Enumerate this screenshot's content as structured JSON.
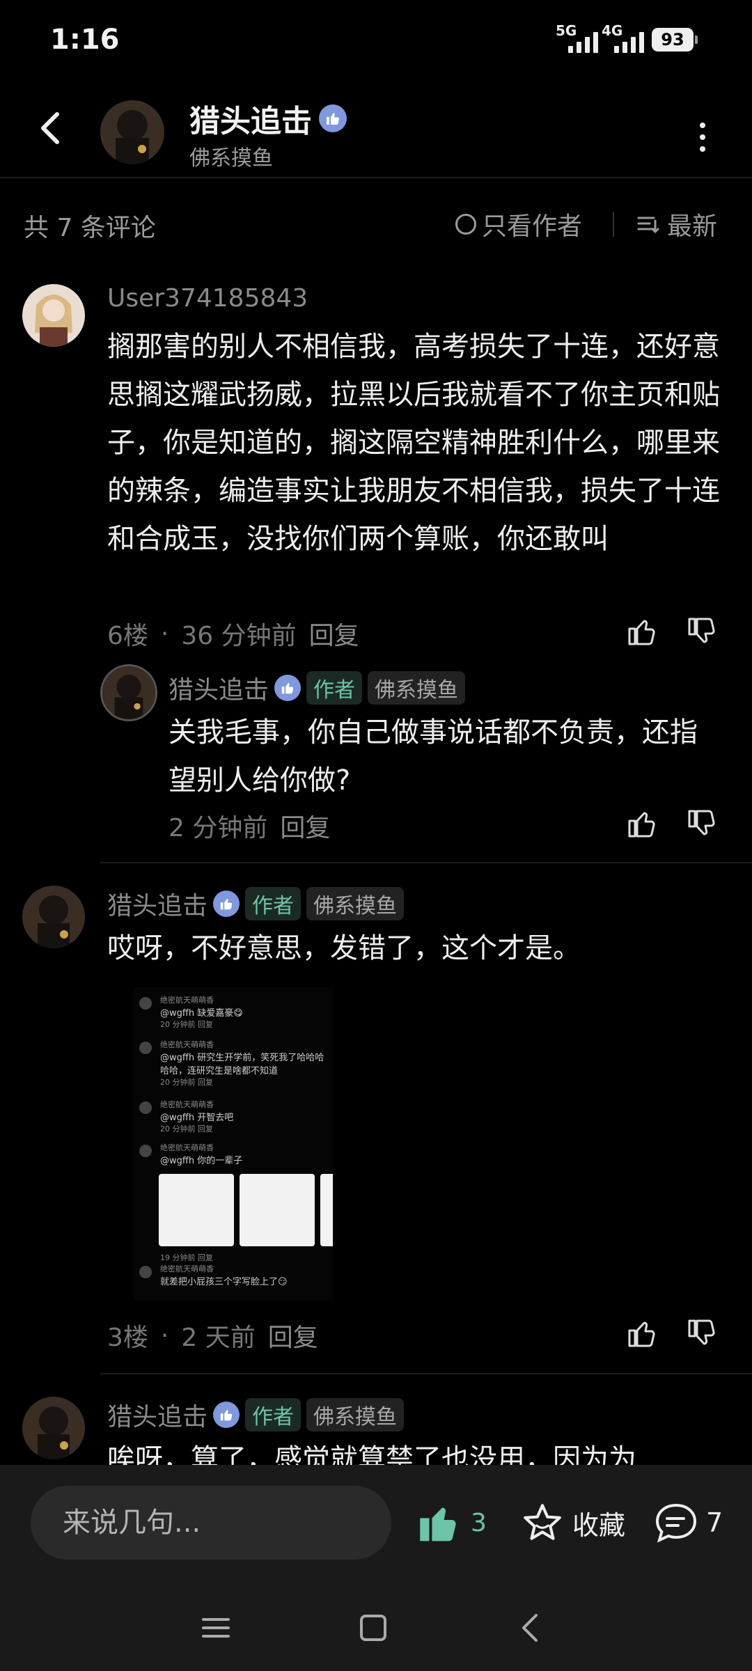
{
  "status_bar": {
    "time": "1:16",
    "signal_1": "5G",
    "signal_2": "4G",
    "battery": "93"
  },
  "header": {
    "title": "猎头追击",
    "subtitle": "佛系摸鱼",
    "back_icon": "back-arrow-icon",
    "more_icon": "more-vertical-icon",
    "verified_icon": "thumbs-up-badge-icon"
  },
  "filter": {
    "count": "共 7 条评论",
    "only_author": "只看作者",
    "sort": "最新"
  },
  "comments": [
    {
      "user": "User374185843",
      "text": "搁那害的别人不相信我，高考损失了十连，还好意思搁这耀武扬威，拉黑以后我就看不了你主页和贴子，你是知道的，搁这隔空精神胜利什么，哪里来的辣条，编造事实让我朋友不相信我，损失了十连和合成玉，没找你们两个算账，你还敢叫",
      "floor": "6楼",
      "time": "36 分钟前",
      "reply": "回复",
      "sub_reply": {
        "user": "猎头追击",
        "author_tag": "作者",
        "group_tag": "佛系摸鱼",
        "text": "关我毛事，你自己做事说话都不负责，还指望别人给你做?",
        "time": "2 分钟前",
        "reply": "回复"
      }
    },
    {
      "user": "猎头追击",
      "author_tag": "作者",
      "group_tag": "佛系摸鱼",
      "text": "哎呀，不好意思，发错了，这个才是。",
      "floor": "3楼",
      "time": "2 天前",
      "reply": "回复",
      "screenshot": {
        "rows": [
          {
            "name": "绝密航天萌萌香",
            "text": "@wgffh  缺爱嘉豪😋",
            "meta": "20 分钟前  回复"
          },
          {
            "name": "绝密航天萌萌香",
            "text": "@wgffh  研究生开学前，笑死我了哈哈哈哈哈，连研究生是啥都不知道",
            "meta": "20 分钟前  回复"
          },
          {
            "name": "绝密航天萌萌香",
            "text": "@wgffh  开智去吧",
            "meta": "20 分钟前  回复"
          },
          {
            "name": "绝密航天萌萌香",
            "text": "@wgffh  你的一辈子",
            "meta": "19 分钟前  回复"
          },
          {
            "name": "绝密航天萌萌香",
            "text": "就差把小屁孩三个字写脸上了😏",
            "meta": ""
          }
        ]
      }
    },
    {
      "user": "猎头追击",
      "author_tag": "作者",
      "group_tag": "佛系摸鱼",
      "text": "唉呀，算了，感觉就算禁了也没用，因为为"
    }
  ],
  "bottom_bar": {
    "placeholder": "来说几句...",
    "likes": "3",
    "favorite": "收藏",
    "comments": "7"
  },
  "colors": {
    "accent": "#6dc4a8",
    "badge": "#7f98de",
    "background": "#000000"
  }
}
